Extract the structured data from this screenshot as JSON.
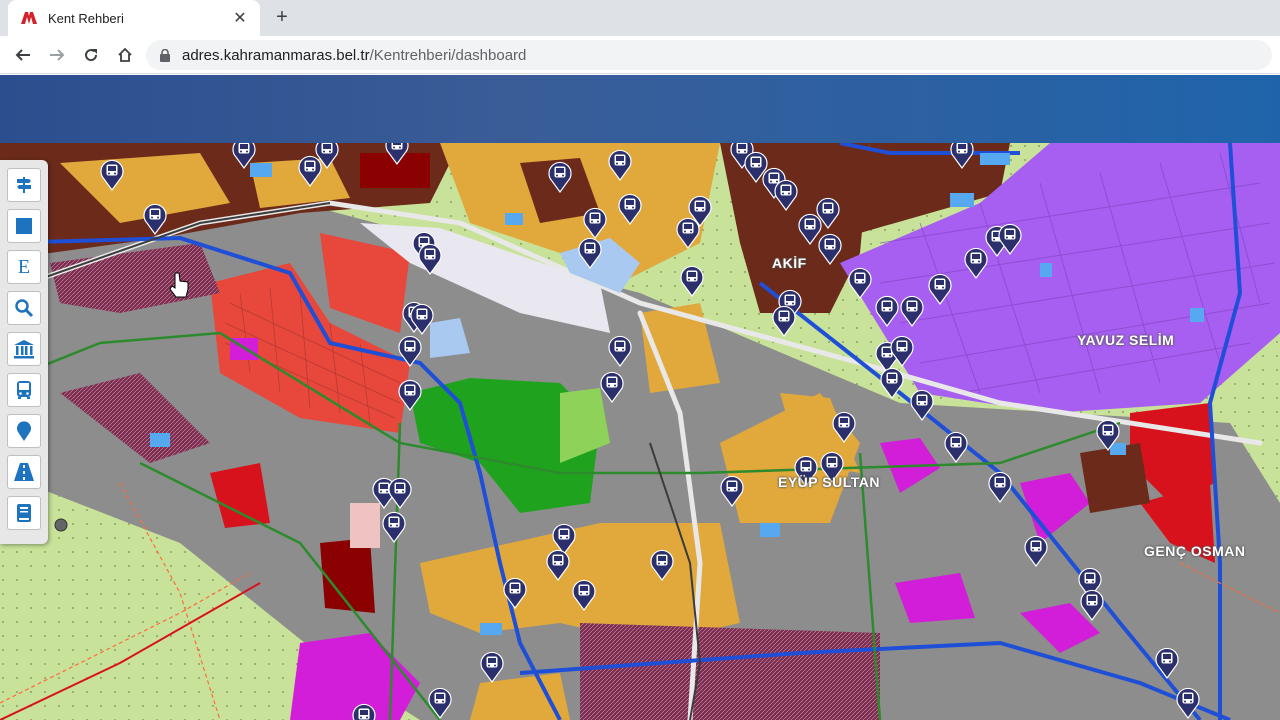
{
  "browser": {
    "tab_title": "Kent Rehberi",
    "tab_close": "✕",
    "new_tab": "+",
    "url_domain": "adres.kahramanmaras.bel.tr",
    "url_path": "/Kentrehberi/dashboard"
  },
  "toolbar_tools": [
    {
      "name": "tool-directions-button",
      "icon": "signpost-icon"
    },
    {
      "name": "tool-layer-button",
      "icon": "square-icon"
    },
    {
      "name": "tool-e-button",
      "icon": "letter-e-icon",
      "label": "E"
    },
    {
      "name": "tool-search-button",
      "icon": "search-icon"
    },
    {
      "name": "tool-institutions-button",
      "icon": "bank-icon"
    },
    {
      "name": "tool-bus-button",
      "icon": "bus-icon"
    },
    {
      "name": "tool-location-button",
      "icon": "location-pin-icon"
    },
    {
      "name": "tool-road-button",
      "icon": "road-icon"
    },
    {
      "name": "tool-book-button",
      "icon": "book-icon"
    }
  ],
  "map": {
    "district_labels": {
      "akif": "AKİF",
      "yavuz_selim": "YAVUZ SELİM",
      "eyup_sultan": "EYÜP SULTAN",
      "genc_osman": "GENÇ OSMAN"
    },
    "colors": {
      "header_gradient_start": "#2b4f8e",
      "header_gradient_end": "#1f64ab",
      "residential_orange": "#e1a93c",
      "residential_brown": "#6b2a1a",
      "commercial_red": "#e8473c",
      "purple_zone": "#a65ff0",
      "park_green": "#1fa31f",
      "agri_green": "#c8e29a",
      "magenta": "#d21ed8",
      "road_blue": "#1f4fd6",
      "bus_pin": "#2b2f6b"
    }
  }
}
